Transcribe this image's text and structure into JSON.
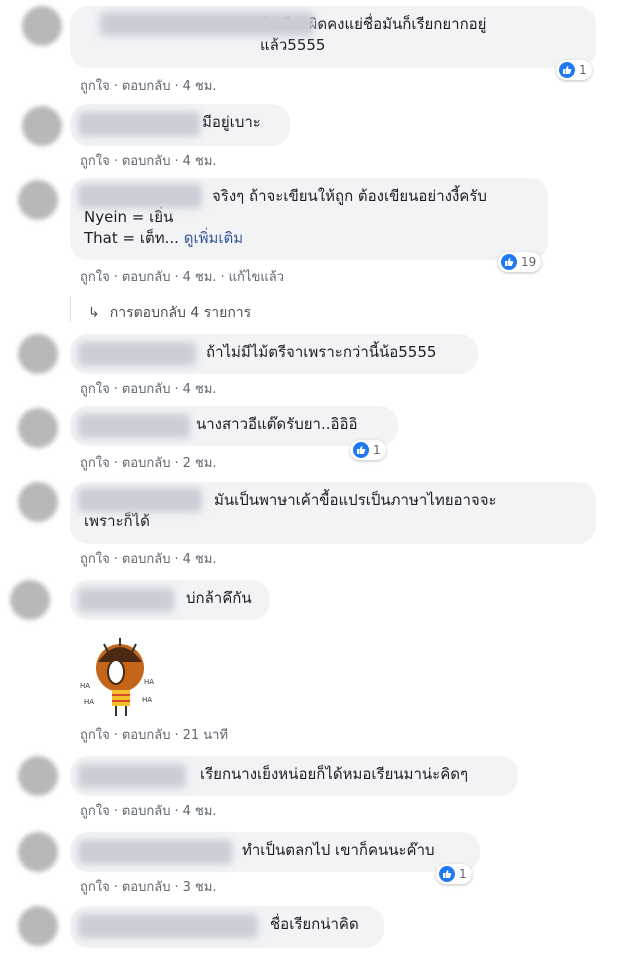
{
  "actions": {
    "like": "ถูกใจ",
    "reply": "ตอบกลับ",
    "edited": "แก้ไขแล้ว",
    "sep": "·"
  },
  "comments": [
    {
      "text": "ถ้าเรียกผิดคงแย่ชื่อมันก็เรียกยากอยู่\nแล้ว5555",
      "time": "4 ชม.",
      "reactions": "1"
    },
    {
      "text": "มีอยู่เบาะ",
      "time": "4 ชม."
    },
    {
      "text_line1": "จริงๆ ถ้าจะเขียนให้ถูก ต้องเขียนอย่างงี้ครับ",
      "text_line2": "Nyein = เยิ่น",
      "text_line3": "That = เต็ท...",
      "see_more": "ดูเพิ่มเติม",
      "time": "4 ชม.",
      "reactions": "19"
    },
    {
      "text": "ถ้าไม่มีไม้ตรีจาเพราะกว่านี้น้อ5555",
      "time": "4 ชม."
    },
    {
      "text": "นางสาวอีแต๊ดรับยา..อิอิอิ",
      "time": "2 ชม.",
      "reactions": "1"
    },
    {
      "text": "มันเป็นพาษาเค้าขื้อแปรเป็นภาษาไทยอาจจะ\nเพราะก็ได้",
      "time": "4 ชม."
    },
    {
      "text": "บ่กล้าคึกัน",
      "time": "21 นาที"
    },
    {
      "text": "เรียกนางเย็งหน่อยก็ได้หมอเรียนมาน่ะคิดๆ",
      "time": "4 ชม."
    },
    {
      "text": "ทำเป็นตลกไป เขาก็คนนะค๊าบ",
      "time": "3 ชม.",
      "reactions": "1"
    },
    {
      "text": "ชื่อเรียกน่าคิด"
    }
  ],
  "replies_link": "การตอบกลับ 4 รายการ",
  "sticker_text": [
    "HA",
    "HA",
    "HA",
    "HA"
  ],
  "colors": {
    "like_blue": "#2078f4",
    "bubble_bg": "#f2f3f5",
    "meta": "#606770"
  }
}
